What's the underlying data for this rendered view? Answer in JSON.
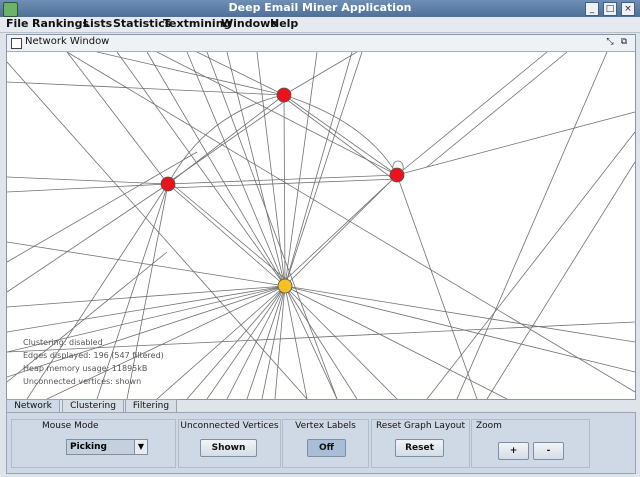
{
  "app": {
    "title": "Deep Email Miner Application"
  },
  "menu": [
    "File",
    "Rankings",
    "Lists",
    "Statistics",
    "Textmining",
    "Windows",
    "Help"
  ],
  "network_window": {
    "title": "Network Window",
    "info": [
      "Clustering: disabled",
      "Edges displayed: 196 (547 filtered)",
      "Heap memory usage: 11895kB",
      "Unconnected vertices: shown"
    ]
  },
  "tabs": [
    {
      "label": "Network",
      "active": true
    },
    {
      "label": "Clustering",
      "active": false
    },
    {
      "label": "Filtering",
      "active": false
    }
  ],
  "controls": {
    "mouse_mode": {
      "title": "Mouse Mode",
      "value": "Picking"
    },
    "unconnected": {
      "title": "Unconnected Vertices",
      "button": "Shown"
    },
    "vertex_labels": {
      "title": "Vertex Labels",
      "button": "Off"
    },
    "reset_layout": {
      "title": "Reset Graph Layout",
      "button": "Reset"
    },
    "zoom": {
      "title": "Zoom",
      "in": "+",
      "out": "-"
    }
  },
  "colors": {
    "vertex_red": "#e8141b",
    "vertex_selected": "#f5c024",
    "edge": "#707070"
  }
}
